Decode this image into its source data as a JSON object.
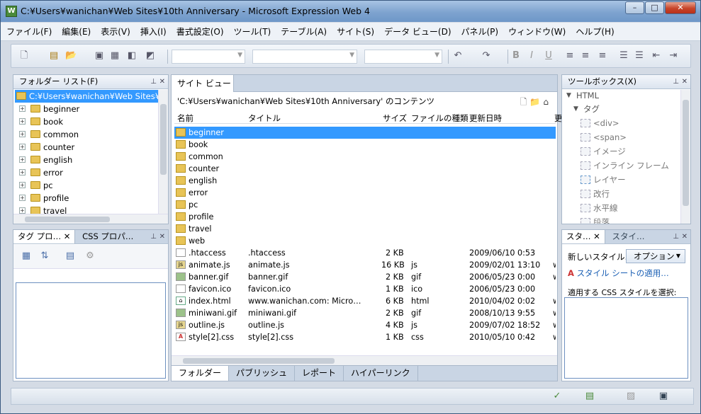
{
  "window": {
    "title": "C:¥Users¥wanichan¥Web Sites¥10th Anniversary - Microsoft Expression Web 4",
    "app_icon": "W",
    "minimize": "–",
    "maximize": "□",
    "close": "✕"
  },
  "menu": [
    "ファイル(F)",
    "編集(E)",
    "表示(V)",
    "挿入(I)",
    "書式設定(O)",
    "ツール(T)",
    "テーブル(A)",
    "サイト(S)",
    "データ ビュー(D)",
    "パネル(P)",
    "ウィンドウ(W)",
    "ヘルプ(H)"
  ],
  "folder_list": {
    "title": "フォルダー リスト(F)",
    "root": "C:¥Users¥wanichan¥Web Sites¥10th",
    "items": [
      "beginner",
      "book",
      "common",
      "counter",
      "english",
      "error",
      "pc",
      "profile",
      "travel"
    ]
  },
  "tag_panel": {
    "tab1": "タグ プロ…",
    "tab2": "CSS プロパ…"
  },
  "site_view": {
    "tab": "サイト ビュー",
    "path": "'C:¥Users¥wanichan¥Web Sites¥10th Anniversary' のコンテンツ",
    "columns": {
      "name": "名前",
      "title": "タイトル",
      "size": "サイズ",
      "type": "ファイルの種類",
      "date": "更新日時",
      "more": "更"
    },
    "folders": [
      "beginner",
      "book",
      "common",
      "counter",
      "english",
      "error",
      "pc",
      "profile",
      "travel",
      "web"
    ],
    "files": [
      {
        "name": ".htaccess",
        "title": ".htaccess",
        "size": "2 KB",
        "type": "",
        "date": "2009/06/10 0:53",
        "extra": ""
      },
      {
        "name": "animate.js",
        "title": "animate.js",
        "size": "16 KB",
        "type": "js",
        "date": "2009/02/01 13:10",
        "extra": "w"
      },
      {
        "name": "banner.gif",
        "title": "banner.gif",
        "size": "2 KB",
        "type": "gif",
        "date": "2006/05/23 0:00",
        "extra": "w"
      },
      {
        "name": "favicon.ico",
        "title": "favicon.ico",
        "size": "1 KB",
        "type": "ico",
        "date": "2006/05/23 0:00",
        "extra": ""
      },
      {
        "name": "index.html",
        "title": "www.wanichan.com: Micro…",
        "size": "6 KB",
        "type": "html",
        "date": "2010/04/02 0:02",
        "extra": "w"
      },
      {
        "name": "miniwani.gif",
        "title": "miniwani.gif",
        "size": "2 KB",
        "type": "gif",
        "date": "2008/10/13 9:55",
        "extra": "w"
      },
      {
        "name": "outline.js",
        "title": "outline.js",
        "size": "4 KB",
        "type": "js",
        "date": "2009/07/02 18:52",
        "extra": "w"
      },
      {
        "name": "style[2].css",
        "title": "style[2].css",
        "size": "1 KB",
        "type": "css",
        "date": "2010/05/10 0:42",
        "extra": "w"
      }
    ],
    "bottom_tabs": [
      "フォルダー",
      "パブリッシュ",
      "レポート",
      "ハイパーリンク"
    ]
  },
  "toolbox": {
    "title": "ツールボックス(X)",
    "html": "HTML",
    "tags": "タグ",
    "items": [
      "<div>",
      "<span>",
      "イメージ",
      "インライン フレーム",
      "レイヤー",
      "改行",
      "水平線",
      "段落"
    ]
  },
  "styles_panel": {
    "tab1": "スタ…",
    "tab2": "スタイ…",
    "new_style": "新しいスタイル…",
    "options": "オプション",
    "attach": "スタイル シートの適用…",
    "select_label": "適用する CSS スタイルを選択:"
  }
}
